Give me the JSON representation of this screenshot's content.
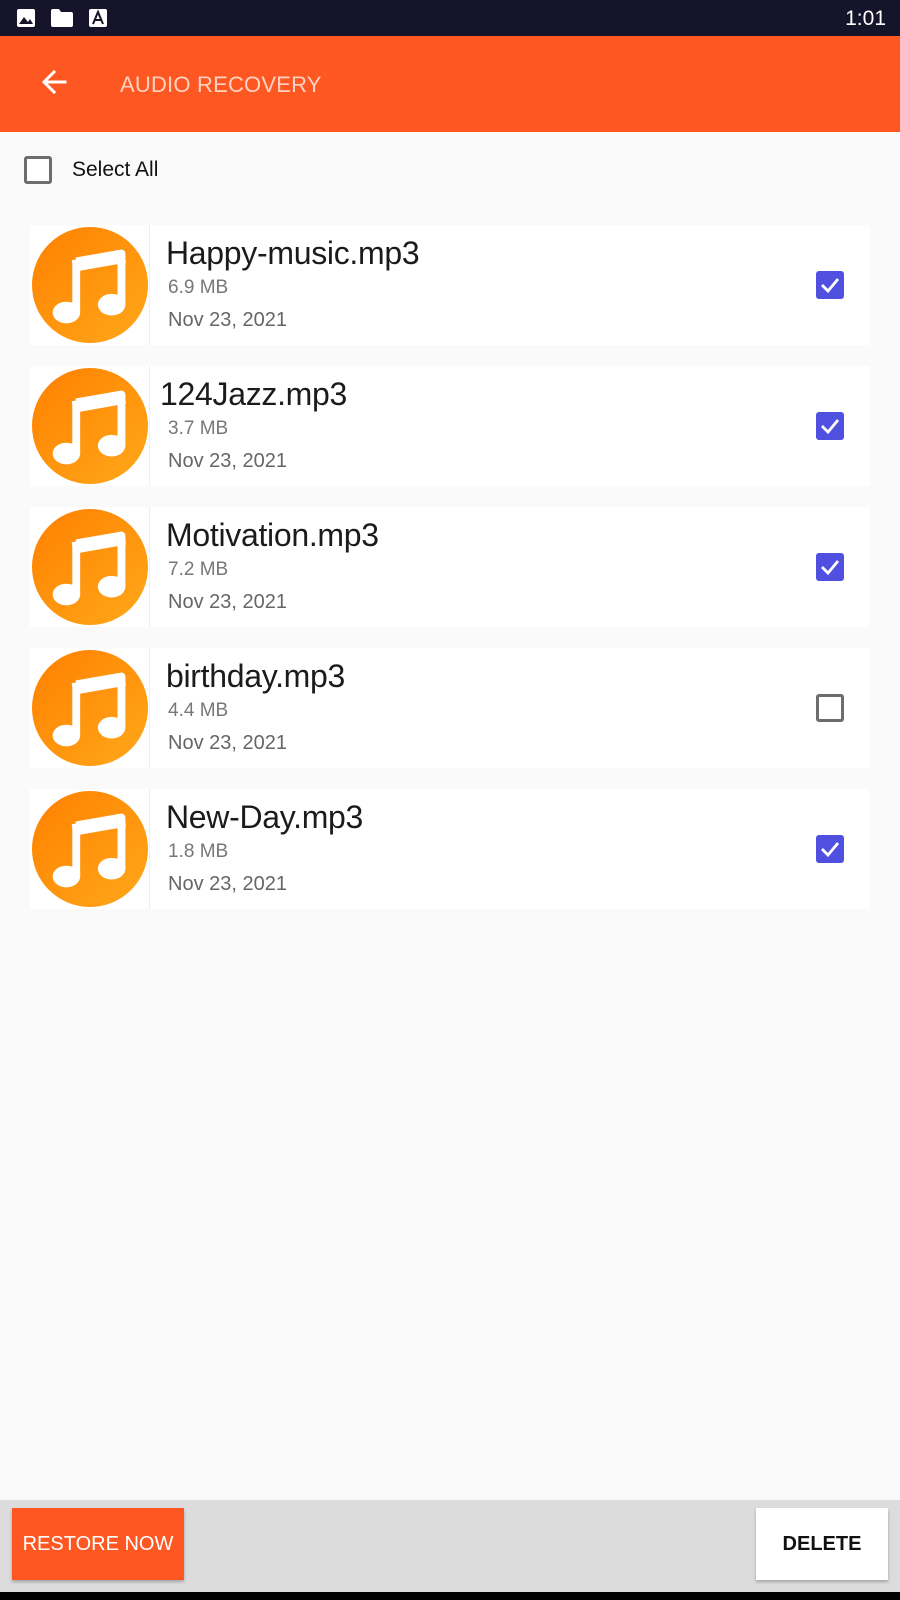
{
  "status_bar": {
    "time": "1:01",
    "icons": [
      "image-icon",
      "folder-icon",
      "font-icon"
    ]
  },
  "app_bar": {
    "title": "AUDIO RECOVERY",
    "back_icon": "arrow-back-icon"
  },
  "select_all": {
    "label": "Select All",
    "checked": false
  },
  "files": [
    {
      "name": "Happy-music.mp3",
      "size": "6.9 MB",
      "date": "Nov 23, 2021",
      "checked": true
    },
    {
      "name": "124Jazz.mp3",
      "size": "3.7 MB",
      "date": "Nov 23, 2021",
      "checked": true
    },
    {
      "name": "Motivation.mp3",
      "size": "7.2 MB",
      "date": "Nov 23, 2021",
      "checked": true
    },
    {
      "name": "birthday.mp3",
      "size": "4.4 MB",
      "date": "Nov 23, 2021",
      "checked": false
    },
    {
      "name": "New-Day.mp3",
      "size": "1.8 MB",
      "date": "Nov 23, 2021",
      "checked": true
    }
  ],
  "bottom_bar": {
    "restore_label": "RESTORE NOW",
    "delete_label": "DELETE"
  },
  "colors": {
    "accent": "#ff5722",
    "status_bar": "#15142a",
    "checkbox_checked": "#4f50e0",
    "music_icon_gradient": [
      "#ff8c00",
      "#ffa41b"
    ]
  }
}
